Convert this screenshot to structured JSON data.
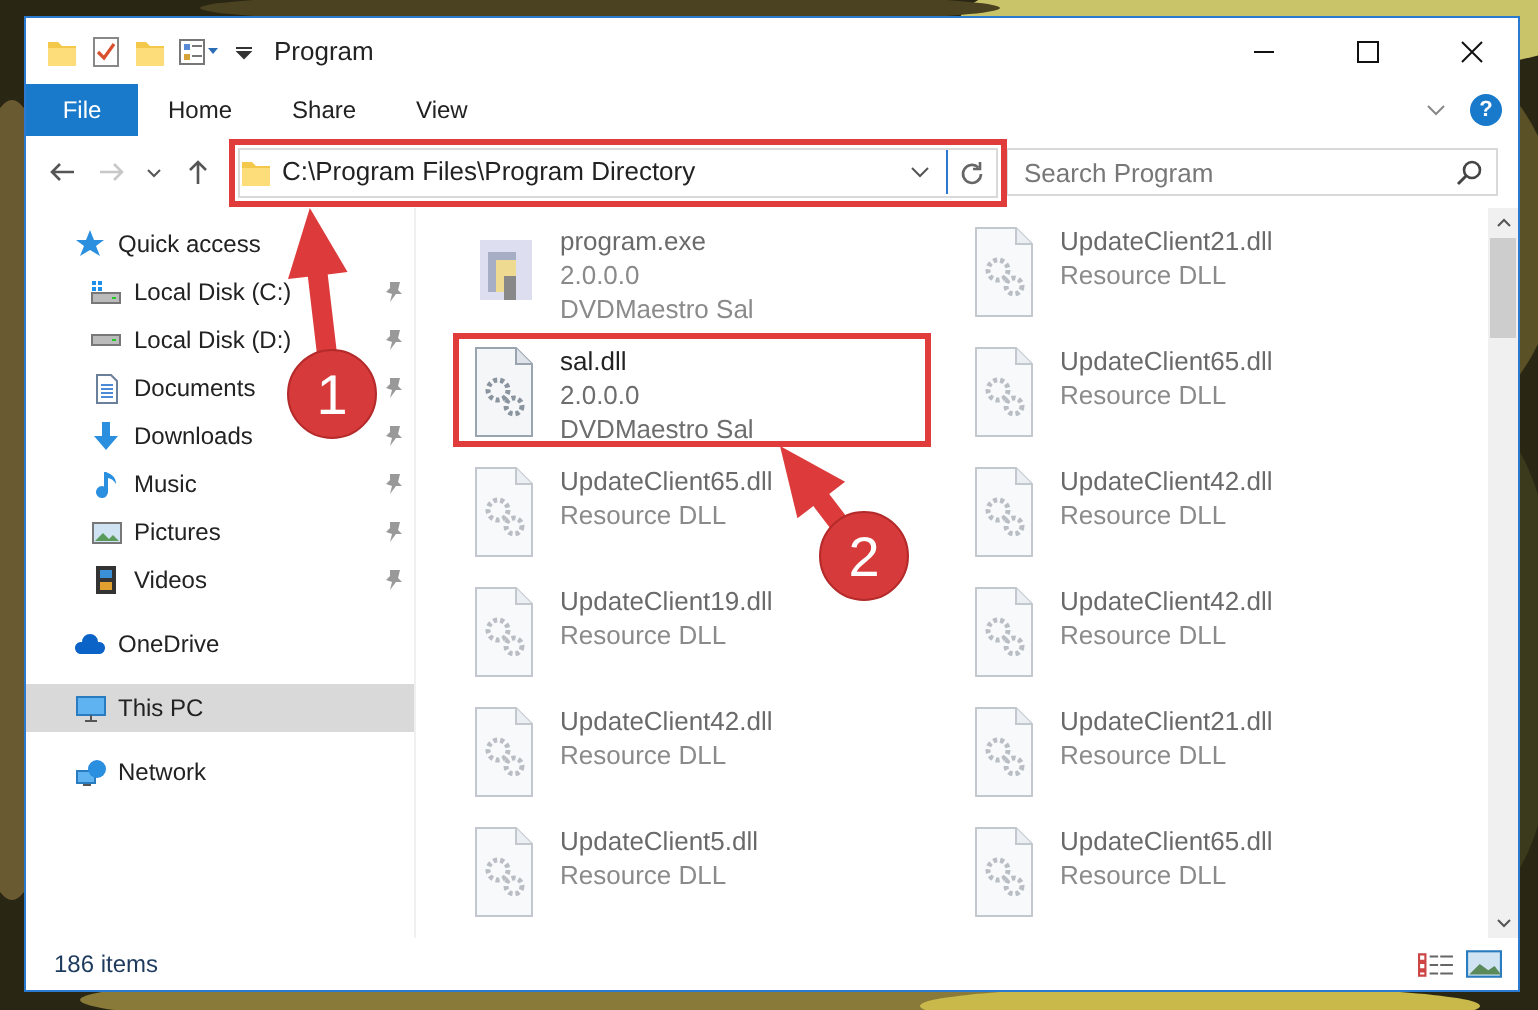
{
  "window": {
    "title": "Program"
  },
  "ribbon": {
    "tabs": [
      {
        "label": "File",
        "kind": "file",
        "selected": false
      },
      {
        "label": "Home",
        "kind": "tab",
        "selected": false
      },
      {
        "label": "Share",
        "kind": "tab",
        "selected": false
      },
      {
        "label": "View",
        "kind": "tab",
        "selected": false
      }
    ],
    "help": "?"
  },
  "navigation": {
    "forward_disabled": true
  },
  "address": {
    "path": "C:\\Program Files\\Program Directory",
    "highlighted": true
  },
  "search": {
    "placeholder": "Search Program"
  },
  "sidebar": {
    "items": [
      {
        "label": "Quick access",
        "kind": "star",
        "selected": false,
        "children": [
          {
            "label": "Local Disk (C:)",
            "kind": "drive-c",
            "pinned": true,
            "selected": false
          },
          {
            "label": "Local Disk (D:)",
            "kind": "drive",
            "pinned": true,
            "selected": false
          },
          {
            "label": "Documents",
            "kind": "documents",
            "pinned": true,
            "selected": false
          },
          {
            "label": "Downloads",
            "kind": "downloads",
            "pinned": true,
            "selected": false
          },
          {
            "label": "Music",
            "kind": "music",
            "pinned": true,
            "selected": false
          },
          {
            "label": "Pictures",
            "kind": "pictures",
            "pinned": true,
            "selected": false
          },
          {
            "label": "Videos",
            "kind": "videos",
            "pinned": true,
            "selected": false
          }
        ]
      },
      {
        "label": "OneDrive",
        "kind": "cloud",
        "selected": false
      },
      {
        "label": "This PC",
        "kind": "pc",
        "selected": true
      },
      {
        "label": "Network",
        "kind": "network",
        "selected": false
      }
    ]
  },
  "files": [
    {
      "name": "program.exe",
      "details": [
        "2.0.0.0",
        "DVDMaestro Sal"
      ],
      "kind": "exe",
      "blurred": true,
      "highlighted": false
    },
    {
      "name": "UpdateClient21.dll",
      "details": [
        "Resource DLL"
      ],
      "kind": "dll",
      "blurred": true,
      "highlighted": false
    },
    {
      "name": "sal.dll",
      "details": [
        "2.0.0.0",
        "DVDMaestro Sal"
      ],
      "kind": "dll",
      "blurred": false,
      "highlighted": true
    },
    {
      "name": "UpdateClient65.dll",
      "details": [
        "Resource DLL"
      ],
      "kind": "dll",
      "blurred": true,
      "highlighted": false
    },
    {
      "name": "UpdateClient65.dll",
      "details": [
        "Resource DLL"
      ],
      "kind": "dll",
      "blurred": true,
      "highlighted": false
    },
    {
      "name": "UpdateClient42.dll",
      "details": [
        "Resource DLL"
      ],
      "kind": "dll",
      "blurred": true,
      "highlighted": false
    },
    {
      "name": "UpdateClient19.dll",
      "details": [
        "Resource DLL"
      ],
      "kind": "dll",
      "blurred": true,
      "highlighted": false
    },
    {
      "name": "UpdateClient42.dll",
      "details": [
        "Resource DLL"
      ],
      "kind": "dll",
      "blurred": true,
      "highlighted": false
    },
    {
      "name": "UpdateClient42.dll",
      "details": [
        "Resource DLL"
      ],
      "kind": "dll",
      "blurred": true,
      "highlighted": false
    },
    {
      "name": "UpdateClient21.dll",
      "details": [
        "Resource DLL"
      ],
      "kind": "dll",
      "blurred": true,
      "highlighted": false
    },
    {
      "name": "UpdateClient5.dll",
      "details": [
        "Resource DLL"
      ],
      "kind": "dll",
      "blurred": true,
      "highlighted": false
    },
    {
      "name": "UpdateClient65.dll",
      "details": [
        "Resource DLL"
      ],
      "kind": "dll",
      "blurred": true,
      "highlighted": false
    }
  ],
  "callouts": [
    {
      "number": "1"
    },
    {
      "number": "2"
    }
  ],
  "status_bar": {
    "items_count": "186 items"
  }
}
